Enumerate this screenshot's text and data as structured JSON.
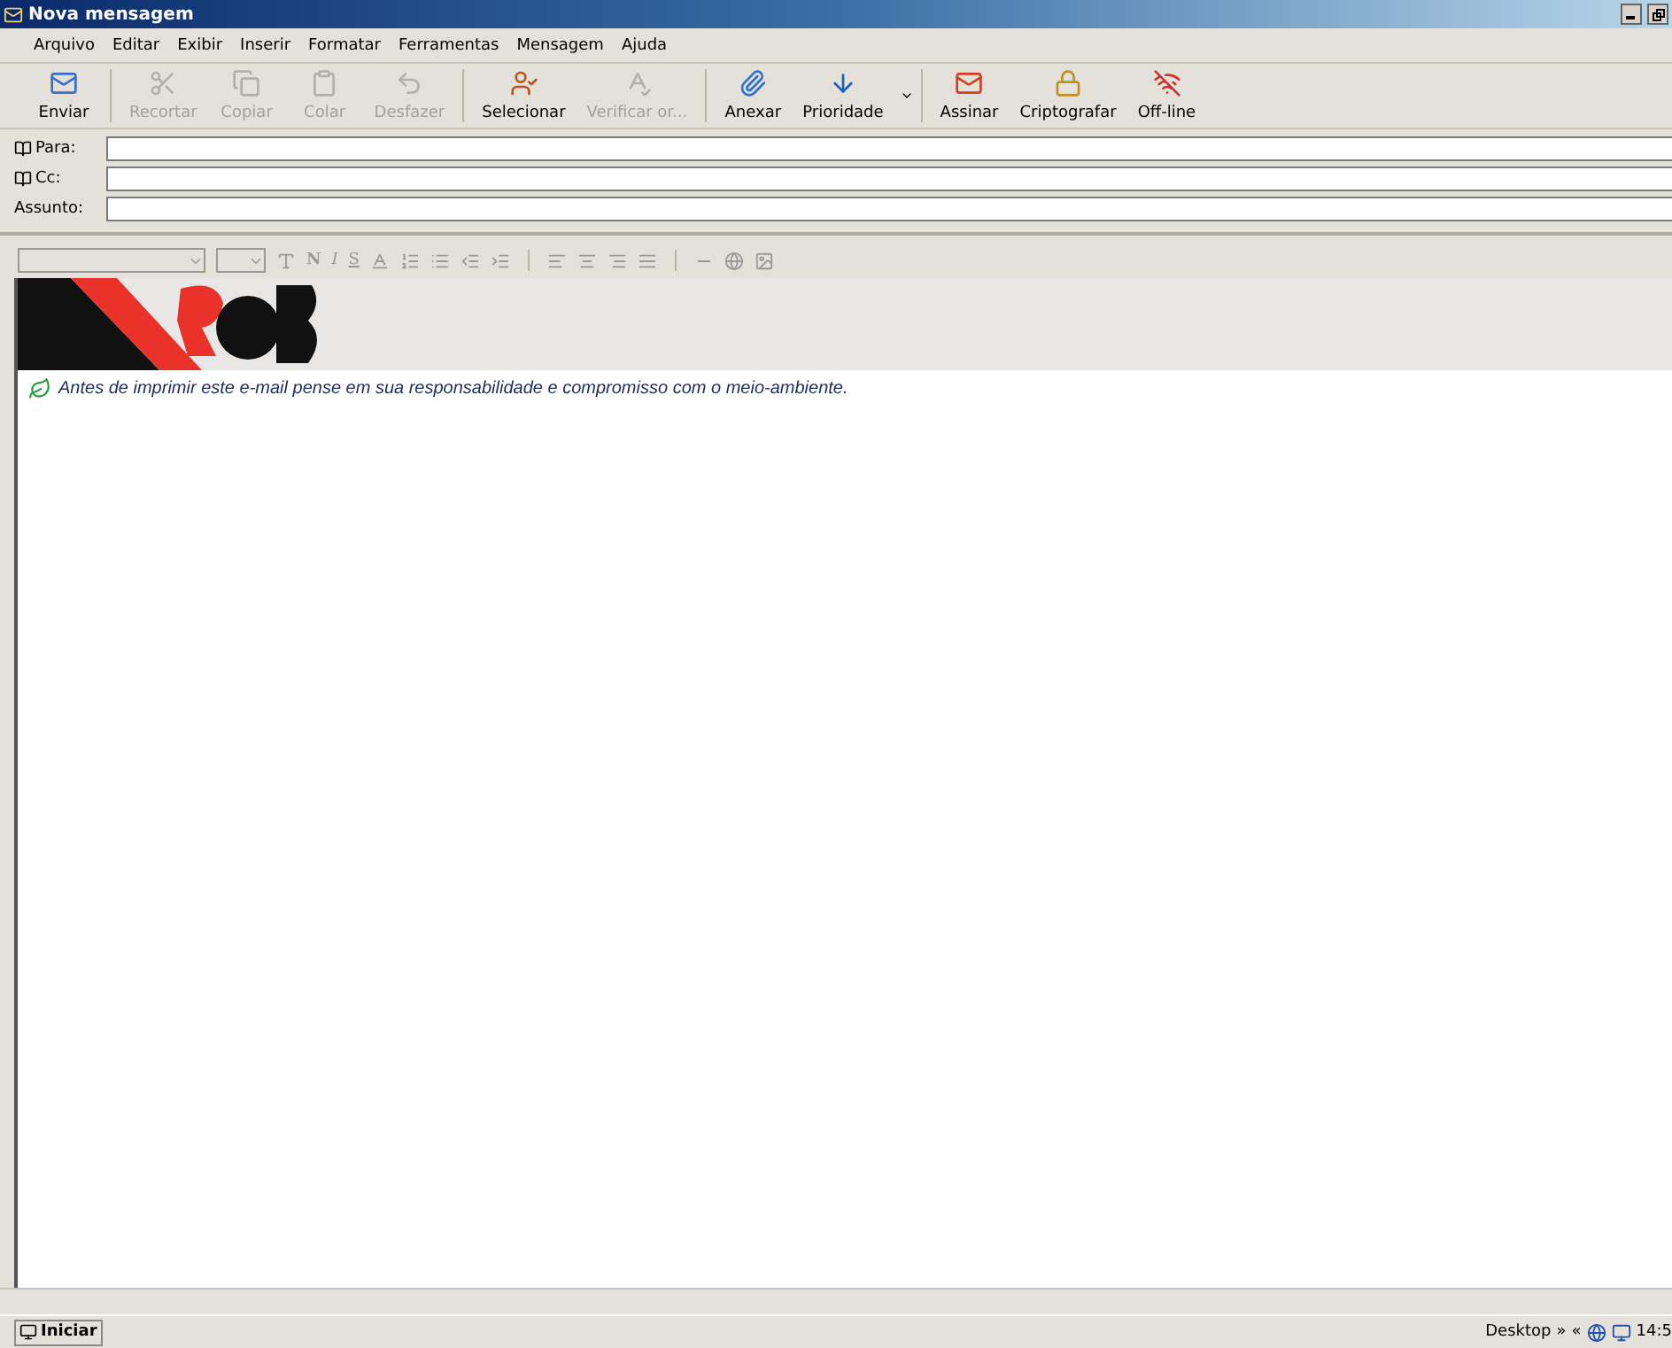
{
  "window": {
    "title": "Nova mensagem"
  },
  "menu": [
    "Arquivo",
    "Editar",
    "Exibir",
    "Inserir",
    "Formatar",
    "Ferramentas",
    "Mensagem",
    "Ajuda"
  ],
  "toolbar": [
    {
      "kind": "send",
      "label": "Enviar",
      "disabled": false
    },
    {
      "kind": "sep"
    },
    {
      "kind": "cut",
      "label": "Recortar",
      "disabled": true
    },
    {
      "kind": "copy",
      "label": "Copiar",
      "disabled": true
    },
    {
      "kind": "paste",
      "label": "Colar",
      "disabled": true
    },
    {
      "kind": "undo",
      "label": "Desfazer",
      "disabled": true
    },
    {
      "kind": "sep"
    },
    {
      "kind": "select",
      "label": "Selecionar",
      "disabled": false
    },
    {
      "kind": "spell",
      "label": "Verificar or...",
      "disabled": true
    },
    {
      "kind": "sep"
    },
    {
      "kind": "attach",
      "label": "Anexar",
      "disabled": false
    },
    {
      "kind": "priority",
      "label": "Prioridade",
      "disabled": false
    },
    {
      "kind": "sep"
    },
    {
      "kind": "sign",
      "label": "Assinar",
      "disabled": false
    },
    {
      "kind": "encrypt",
      "label": "Criptografar",
      "disabled": false
    },
    {
      "kind": "offline",
      "label": "Off-line",
      "disabled": false
    }
  ],
  "fields": [
    {
      "kind": "book",
      "label": "Para:"
    },
    {
      "kind": "book",
      "label": "Cc:"
    },
    {
      "kind": "plain",
      "label": "Assunto:"
    }
  ],
  "format_toolbar": {
    "bold": "N",
    "italic": "I",
    "underline": "S"
  },
  "body": {
    "notice": "Antes de imprimir este e-mail pense em sua responsabilidade e compromisso com o meio-ambiente."
  },
  "taskbar": {
    "start": "Iniciar",
    "desktop": "Desktop",
    "expand": "»",
    "collapse": "«",
    "clock": "14:5"
  }
}
